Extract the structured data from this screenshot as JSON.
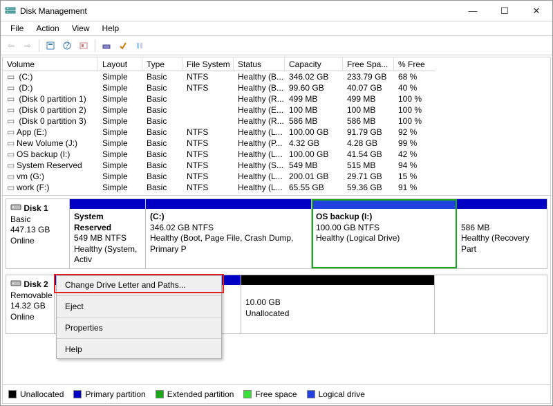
{
  "title": "Disk Management",
  "menus": {
    "file": "File",
    "action": "Action",
    "view": "View",
    "help": "Help"
  },
  "headers": {
    "volume": "Volume",
    "layout": "Layout",
    "type": "Type",
    "fs": "File System",
    "status": "Status",
    "capacity": "Capacity",
    "free": "Free Spa...",
    "pct": "% Free"
  },
  "volumes": [
    {
      "name": " (C:)",
      "layout": "Simple",
      "type": "Basic",
      "fs": "NTFS",
      "status": "Healthy (B...",
      "cap": "346.02 GB",
      "free": "233.79 GB",
      "pct": "68 %"
    },
    {
      "name": " (D:)",
      "layout": "Simple",
      "type": "Basic",
      "fs": "NTFS",
      "status": "Healthy (B...",
      "cap": "99.60 GB",
      "free": "40.07 GB",
      "pct": "40 %"
    },
    {
      "name": " (Disk 0 partition 1)",
      "layout": "Simple",
      "type": "Basic",
      "fs": "",
      "status": "Healthy (R...",
      "cap": "499 MB",
      "free": "499 MB",
      "pct": "100 %"
    },
    {
      "name": " (Disk 0 partition 2)",
      "layout": "Simple",
      "type": "Basic",
      "fs": "",
      "status": "Healthy (E...",
      "cap": "100 MB",
      "free": "100 MB",
      "pct": "100 %"
    },
    {
      "name": " (Disk 0 partition 3)",
      "layout": "Simple",
      "type": "Basic",
      "fs": "",
      "status": "Healthy (R...",
      "cap": "586 MB",
      "free": "586 MB",
      "pct": "100 %"
    },
    {
      "name": "App (E:)",
      "layout": "Simple",
      "type": "Basic",
      "fs": "NTFS",
      "status": "Healthy (L...",
      "cap": "100.00 GB",
      "free": "91.79 GB",
      "pct": "92 %"
    },
    {
      "name": "New Volume (J:)",
      "layout": "Simple",
      "type": "Basic",
      "fs": "NTFS",
      "status": "Healthy (P...",
      "cap": "4.32 GB",
      "free": "4.28 GB",
      "pct": "99 %"
    },
    {
      "name": "OS backup (I:)",
      "layout": "Simple",
      "type": "Basic",
      "fs": "NTFS",
      "status": "Healthy (L...",
      "cap": "100.00 GB",
      "free": "41.54 GB",
      "pct": "42 %"
    },
    {
      "name": "System Reserved",
      "layout": "Simple",
      "type": "Basic",
      "fs": "NTFS",
      "status": "Healthy (S...",
      "cap": "549 MB",
      "free": "515 MB",
      "pct": "94 %"
    },
    {
      "name": "vm (G:)",
      "layout": "Simple",
      "type": "Basic",
      "fs": "NTFS",
      "status": "Healthy (L...",
      "cap": "200.01 GB",
      "free": "29.71 GB",
      "pct": "15 %"
    },
    {
      "name": "work (F:)",
      "layout": "Simple",
      "type": "Basic",
      "fs": "NTFS",
      "status": "Healthy (L...",
      "cap": "65.55 GB",
      "free": "59.36 GB",
      "pct": "91 %"
    }
  ],
  "disk1": {
    "name": "Disk 1",
    "type": "Basic",
    "size": "447.13 GB",
    "state": "Online",
    "parts": {
      "p0": {
        "title": "System Reserved",
        "line2": "549 MB NTFS",
        "line3": "Healthy (System, Activ"
      },
      "p1": {
        "title": "(C:)",
        "line2": "346.02 GB NTFS",
        "line3": "Healthy (Boot, Page File, Crash Dump, Primary P"
      },
      "p2": {
        "title": "OS backup  (I:)",
        "line2": "100.00 GB NTFS",
        "line3": "Healthy (Logical Drive)"
      },
      "p3": {
        "title": "",
        "line2": "586 MB",
        "line3": "Healthy (Recovery Part"
      }
    }
  },
  "disk2": {
    "name": "Disk 2",
    "type": "Removable",
    "size": "14.32 GB",
    "state": "Online",
    "parts": {
      "p0": {
        "title": "",
        "line2": "",
        "line3": ""
      },
      "p1": {
        "title": "",
        "line2": "10.00 GB",
        "line3": "Unallocated"
      }
    }
  },
  "context": {
    "change": "Change Drive Letter and Paths...",
    "eject": "Eject",
    "props": "Properties",
    "help": "Help"
  },
  "legend": {
    "unalloc": "Unallocated",
    "primary": "Primary partition",
    "extended": "Extended partition",
    "free": "Free space",
    "logical": "Logical drive"
  },
  "colors": {
    "unalloc": "#000000",
    "primary": "#0000c4",
    "extended": "#1aa81a",
    "free": "#3ae03a",
    "logical": "#2040e0"
  }
}
